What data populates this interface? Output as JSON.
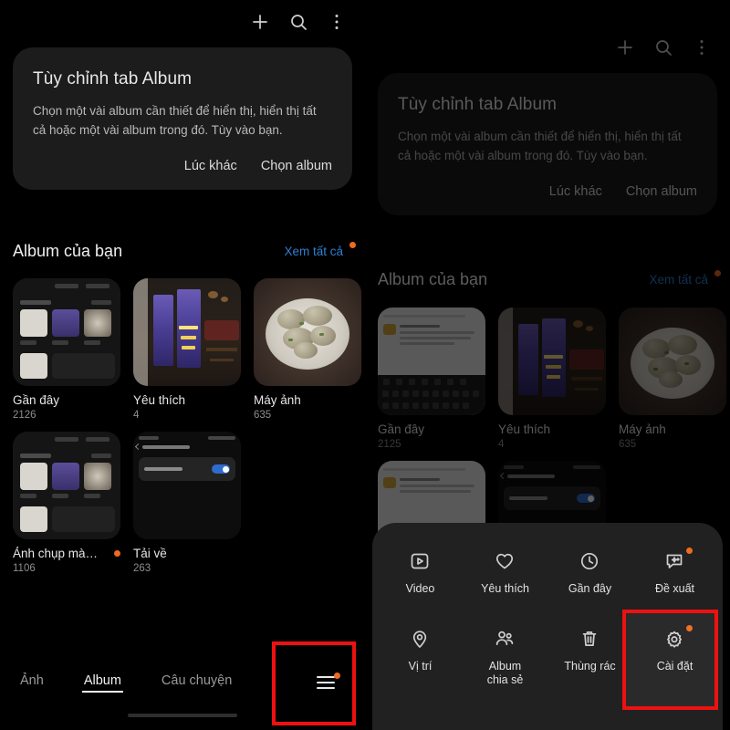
{
  "app": {
    "topbar": {
      "add_icon": "plus-icon",
      "search_icon": "search-icon",
      "more_icon": "more-vertical-icon"
    },
    "info_card": {
      "title": "Tùy chỉnh tab Album",
      "body": "Chọn một vài album cần thiết để hiển thị, hiển thị tất cả hoặc một vài album trong đó. Tùy vào bạn.",
      "dismiss_label": "Lúc khác",
      "primary_label": "Chọn album"
    },
    "section": {
      "title": "Album của bạn",
      "see_all_label": "Xem tất cả",
      "see_all_has_badge": true
    },
    "albums_left": [
      {
        "name": "Gần đây",
        "count": "2126",
        "badge": false,
        "art": "shot-ui"
      },
      {
        "name": "Yêu thích",
        "count": "4",
        "badge": false,
        "art": "poster"
      },
      {
        "name": "Máy ảnh",
        "count": "635",
        "badge": false,
        "art": "food"
      },
      {
        "name": "Ảnh chụp mà…",
        "count": "1106",
        "badge": true,
        "art": "shot-ui"
      },
      {
        "name": "Tải về",
        "count": "263",
        "badge": false,
        "art": "toggle"
      }
    ],
    "albums_right": [
      {
        "name": "Gần đây",
        "count": "2125",
        "badge": false,
        "art": "light"
      },
      {
        "name": "Yêu thích",
        "count": "4",
        "badge": false,
        "art": "poster"
      },
      {
        "name": "Máy ảnh",
        "count": "635",
        "badge": false,
        "art": "food"
      }
    ],
    "tabs": [
      {
        "label": "Ảnh",
        "active": false
      },
      {
        "label": "Album",
        "active": true
      },
      {
        "label": "Câu chuyện",
        "active": false
      }
    ],
    "menu_button": {
      "icon": "hamburger-menu-icon",
      "has_badge": true
    },
    "bottom_sheet": {
      "items": [
        {
          "label": "Video",
          "icon": "video-icon",
          "badge": false,
          "highlighted": false
        },
        {
          "label": "Yêu thích",
          "icon": "heart-icon",
          "badge": false,
          "highlighted": false
        },
        {
          "label": "Gần đây",
          "icon": "clock-icon",
          "badge": false,
          "highlighted": false
        },
        {
          "label": "Đề xuất",
          "icon": "suggestion-icon",
          "badge": true,
          "highlighted": false
        },
        {
          "label": "Vị trí",
          "icon": "location-pin-icon",
          "badge": false,
          "highlighted": false
        },
        {
          "label": "Album\nchia sẻ",
          "icon": "people-icon",
          "badge": false,
          "highlighted": false
        },
        {
          "label": "Thùng rác",
          "icon": "trash-icon",
          "badge": false,
          "highlighted": false
        },
        {
          "label": "Cài đặt",
          "icon": "gear-icon",
          "badge": true,
          "highlighted": true
        }
      ]
    },
    "colors": {
      "highlight_box": "#ee1111",
      "badge_dot": "#ee6b1e",
      "link": "#2e7fd4",
      "sheet_bg": "#212121",
      "card_bg": "#1c1c1c"
    }
  }
}
